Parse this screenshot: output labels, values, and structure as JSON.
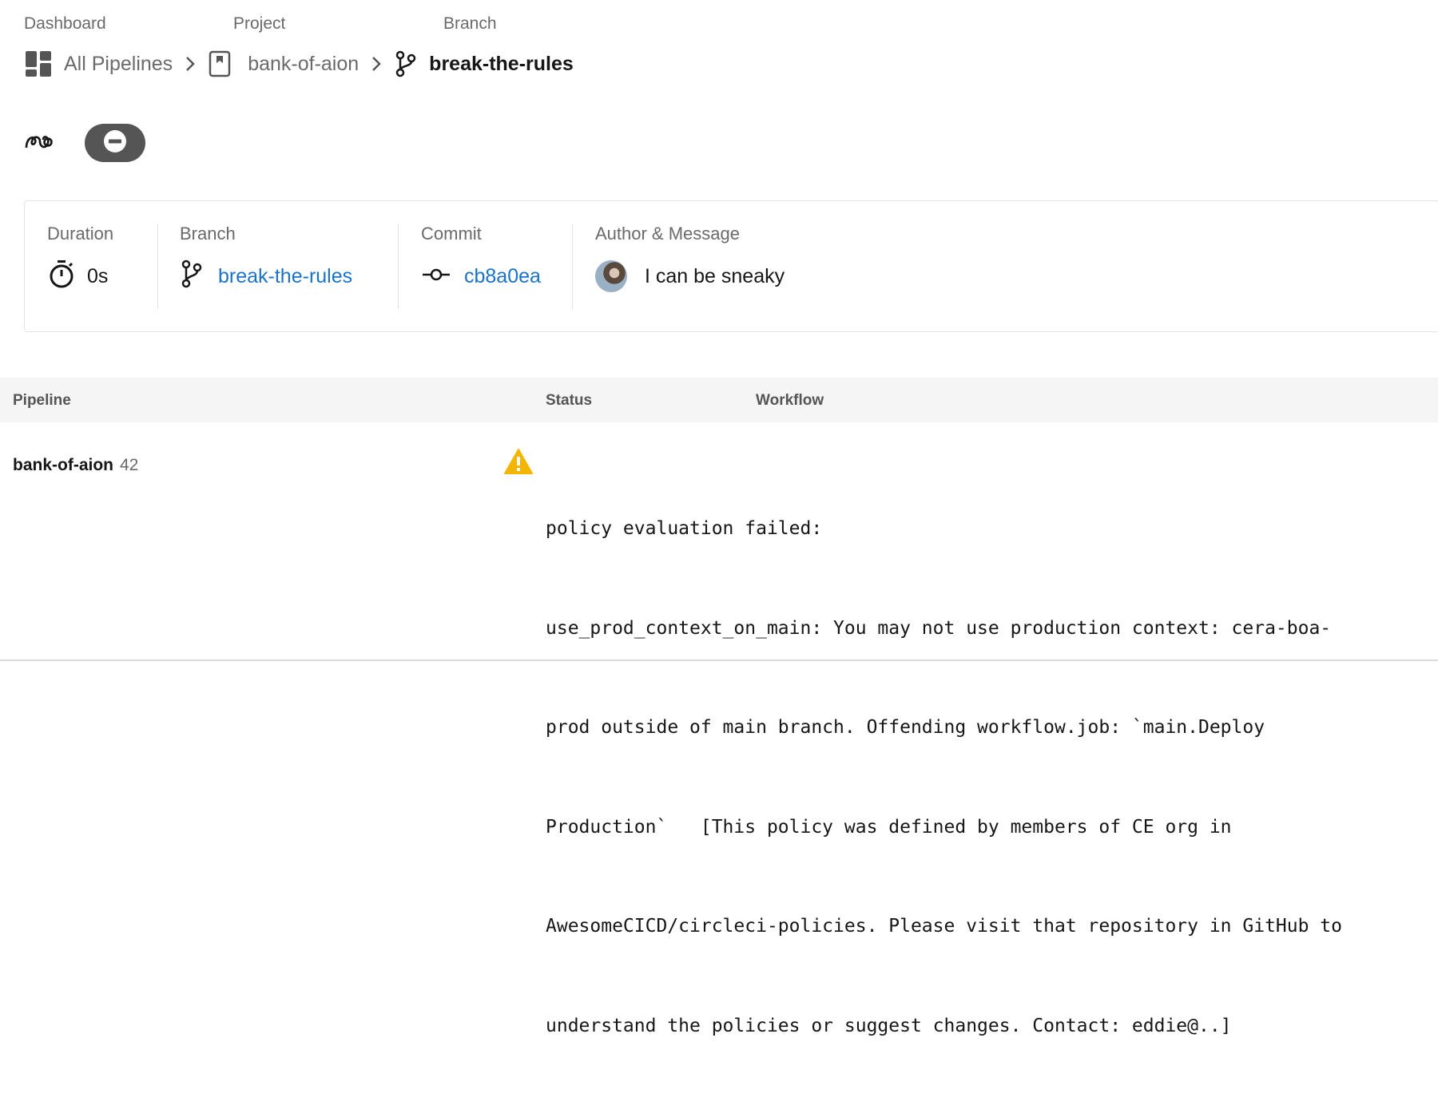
{
  "breadcrumb": {
    "labels": {
      "dashboard": "Dashboard",
      "project": "Project",
      "branch": "Branch"
    },
    "all_pipelines": "All Pipelines",
    "project": "bank-of-aion",
    "branch": "break-the-rules",
    "icons": [
      "dashboard-grid-icon",
      "chevron-right-icon",
      "project-bookmark-icon",
      "git-branch-icon"
    ]
  },
  "actions": {
    "icons": [
      "pipeline-trigger-icon",
      "minus-circle-icon"
    ],
    "status_pill_color": "#555555"
  },
  "summary": {
    "duration": {
      "label": "Duration",
      "value": "0s",
      "icon": "stopwatch-icon"
    },
    "branch": {
      "label": "Branch",
      "value": "break-the-rules",
      "icon": "git-branch-icon"
    },
    "commit": {
      "label": "Commit",
      "value": "cb8a0ea",
      "icon": "git-commit-icon"
    },
    "author": {
      "label": "Author & Message",
      "message": "I can be sneaky",
      "icon": "avatar"
    }
  },
  "table": {
    "headers": {
      "pipeline": "Pipeline",
      "status": "Status",
      "workflow": "Workflow"
    },
    "rows": [
      {
        "pipeline": "bank-of-aion",
        "number": "42",
        "status_icon": "warning-icon",
        "status_lines": [
          "policy evaluation failed:",
          "use_prod_context_on_main: You may not use production context: cera-boa-",
          "prod outside of main branch. Offending workflow.job: `main.Deploy",
          "Production`   [This policy was defined by members of CE org in",
          "AwesomeCICD/circleci-policies. Please visit that repository in GitHub to",
          "understand the policies or suggest changes. Contact: eddie@..]"
        ]
      }
    ]
  },
  "colors": {
    "link": "#1a73c8",
    "warning": "#f2b600",
    "muted_text": "#6a6a6a",
    "header_bg": "#f5f5f5"
  }
}
